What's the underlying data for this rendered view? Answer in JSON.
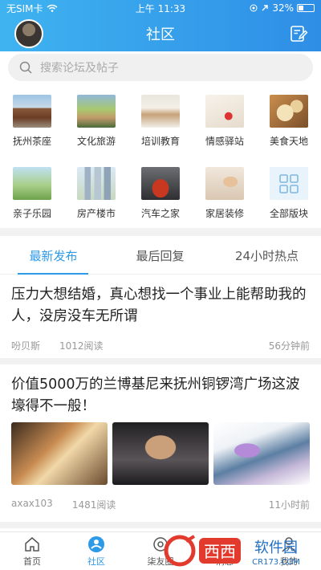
{
  "status": {
    "carrier": "无SIM卡",
    "time": "上午 11:33",
    "battery": "32%"
  },
  "nav": {
    "title": "社区"
  },
  "search": {
    "placeholder": "搜索论坛及帖子"
  },
  "categories": [
    {
      "label": "抚州茶座",
      "icon": "pavilion-photo"
    },
    {
      "label": "文化旅游",
      "icon": "tourists-photo"
    },
    {
      "label": "培训教育",
      "icon": "classroom-photo"
    },
    {
      "label": "情感驿站",
      "icon": "love-note-photo"
    },
    {
      "label": "美食天地",
      "icon": "food-photo"
    },
    {
      "label": "亲子乐园",
      "icon": "family-photo"
    },
    {
      "label": "房产楼市",
      "icon": "buildings-photo"
    },
    {
      "label": "汽车之家",
      "icon": "car-photo"
    },
    {
      "label": "家居装修",
      "icon": "home-photo"
    },
    {
      "label": "全部版块",
      "icon": "grid-icon"
    }
  ],
  "tabs": [
    {
      "label": "最新发布",
      "active": true
    },
    {
      "label": "最后回复",
      "active": false
    },
    {
      "label": "24小时热点",
      "active": false
    }
  ],
  "posts": [
    {
      "title": "压力大想结婚，真心想找一个事业上能帮助我的人，没房没车无所谓",
      "author": "吩贝斯",
      "reads": "1012阅读",
      "time": "56分钟前"
    },
    {
      "title": "价值5000万的兰博基尼来抚州铜锣湾广场这波壕得不一般！",
      "author": "axax103",
      "reads": "1481阅读",
      "time": "11小时前"
    }
  ],
  "tabbar": [
    {
      "label": "首页",
      "icon": "home-icon",
      "active": false
    },
    {
      "label": "社区",
      "icon": "community-icon",
      "active": true
    },
    {
      "label": "柒友圈",
      "icon": "circle-icon",
      "active": false
    },
    {
      "label": "消息",
      "icon": "message-icon",
      "active": false
    },
    {
      "label": "我的",
      "icon": "profile-icon",
      "active": false
    }
  ],
  "watermark": {
    "text": "西西软件园",
    "url": "CR173.COM"
  },
  "colors": {
    "accent": "#2d9ae8",
    "header_start": "#3fb3f0",
    "header_end": "#2e8ee6"
  }
}
